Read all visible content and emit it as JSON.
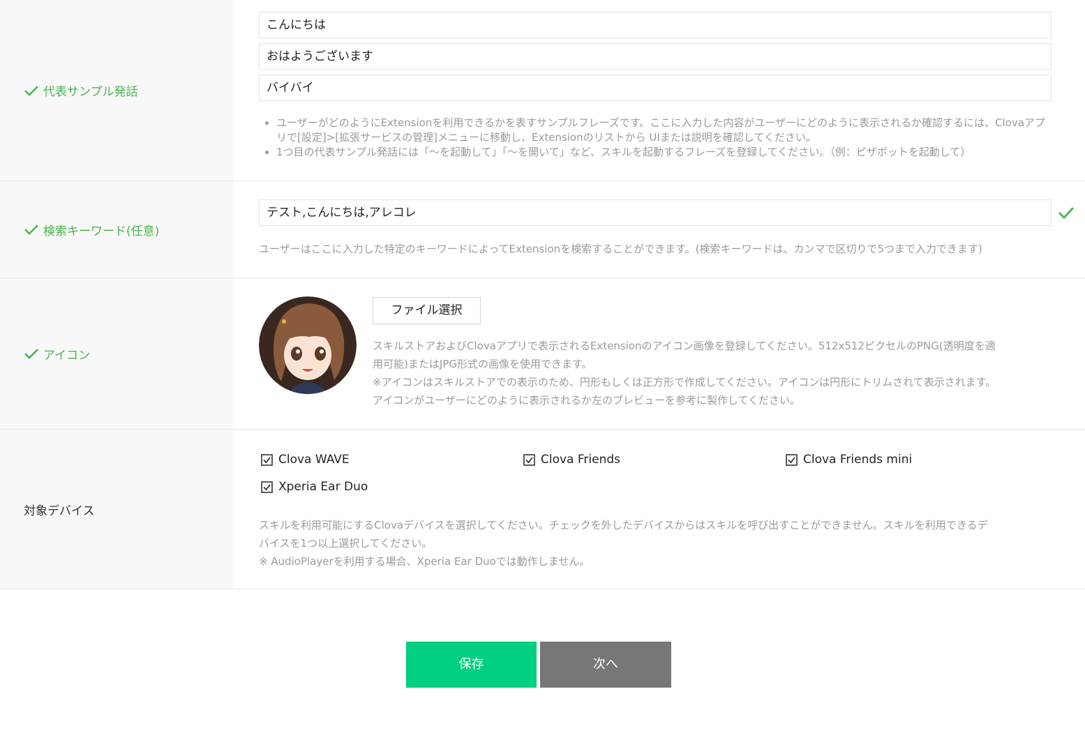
{
  "sample_utterance": {
    "label": "代表サンプル発話",
    "inputs": [
      "こんにちは",
      "おはようございます",
      "バイバイ"
    ],
    "hints": [
      "ユーザーがどのようにExtensionを利用できるかを表すサンプルフレーズです。ここに入力した内容がユーザーにどのように表示されるか確認するには、Clovaアプリで[設定]>[拡張サービスの管理]メニューに移動し、Extensionのリストから UIまたは説明を確認してください。",
      "1つ目の代表サンプル発話には「〜を起動して」「〜を開いて」など、スキルを起動するフレーズを登録してください。（例：ピザボットを起動して）"
    ]
  },
  "search_keyword": {
    "label": "検索キーワード(任意)",
    "value": "テスト,こんにちは,アレコレ",
    "hint": "ユーザーはここに入力した特定のキーワードによってExtensionを検索することができます。(検索キーワードは、カンマで区切りで5つまで入力できます)"
  },
  "icon": {
    "label": "アイコン",
    "file_button": "ファイル選択",
    "description_lines": [
      "スキルストアおよびClovaアプリで表示されるExtensionのアイコン画像を登録してください。512x512ピクセルのPNG(透明度を適",
      "用可能)またはJPG形式の画像を使用できます。",
      "※アイコンはスキルストアでの表示のため、円形もしくは正方形で作成してください。アイコンは円形にトリムされて表示されます。",
      "アイコンがユーザーにどのように表示されるか左のプレビューを参考に製作してください。"
    ]
  },
  "devices": {
    "label": "対象デバイス",
    "options": [
      {
        "name": "Clova WAVE",
        "checked": true
      },
      {
        "name": "Clova Friends",
        "checked": true
      },
      {
        "name": "Clova Friends mini",
        "checked": true
      },
      {
        "name": "Xperia Ear Duo",
        "checked": true
      }
    ],
    "hint_lines": [
      "スキルを利用可能にするClovaデバイスを選択してください。チェックを外したデバイスからはスキルを呼び出すことができません。スキルを利用できるデ",
      "バイスを1つ以上選択してください。",
      "※ AudioPlayerを利用する場合、Xperia Ear Duoでは動作しません。"
    ]
  },
  "actions": {
    "save": "保存",
    "next": "次へ"
  },
  "colors": {
    "accent_green": "#4cb450",
    "save_bg": "#03cf80",
    "next_bg": "#777777"
  }
}
